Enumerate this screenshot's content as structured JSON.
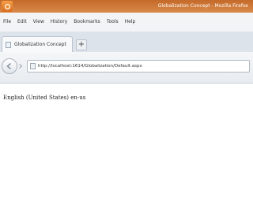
{
  "window": {
    "title": "Globalization Concept - Mozilla Firefox",
    "app_icon": "firefox-icon"
  },
  "menu": {
    "items": [
      "File",
      "Edit",
      "View",
      "History",
      "Bookmarks",
      "Tools",
      "Help"
    ]
  },
  "tabs": [
    {
      "label": "Globalization Concept",
      "icon": "page-icon"
    }
  ],
  "new_tab_label": "+",
  "navigation": {
    "url": "http://localhost:1614/Globalization/Default.aspx"
  },
  "content": {
    "culture_text": "English (United States) en-us"
  }
}
